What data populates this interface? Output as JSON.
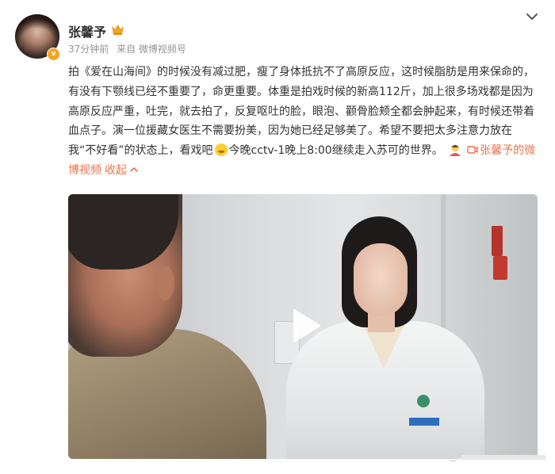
{
  "header": {
    "username": "张馨予",
    "time": "37分钟前",
    "source": "来自 微博视频号",
    "verified_badge": "v"
  },
  "content": {
    "text": "拍《爱在山海间》的时候没有减过肥，瘦了身体抵抗不了高原反应，这时候脂肪是用来保命的，有没有下颚线已经不重要了，命更重要。体重是拍戏时候的新高112斤，加上很多场戏都是因为高原反应严重，吐完，就去拍了，反复呕吐的脸，眼泡、颧骨脸颊全都会肿起来，有时候还带着血点子。演一位援藏女医生不需要扮美，因为她已经足够美了。希望不要把太多注意力放在我“不好看”的状态上，看戏吧",
    "text_after_emoji": "今晚cctv-1晚上8:00继续走入苏可的世界。",
    "video_link": "张馨予的微博视频",
    "collapse": "收起"
  },
  "icons": {
    "member": "member-crown-icon",
    "more": "chevron-down-icon",
    "emoji": "smile-emoji-icon",
    "tail_emoji": "person-emoji-icon",
    "video_link": "video-link-icon",
    "collapse": "chevron-up-icon",
    "play": "play-icon"
  },
  "colors": {
    "accent": "#eb7350",
    "text": "#333333",
    "meta": "#939393",
    "verified": "#f7a51c"
  }
}
